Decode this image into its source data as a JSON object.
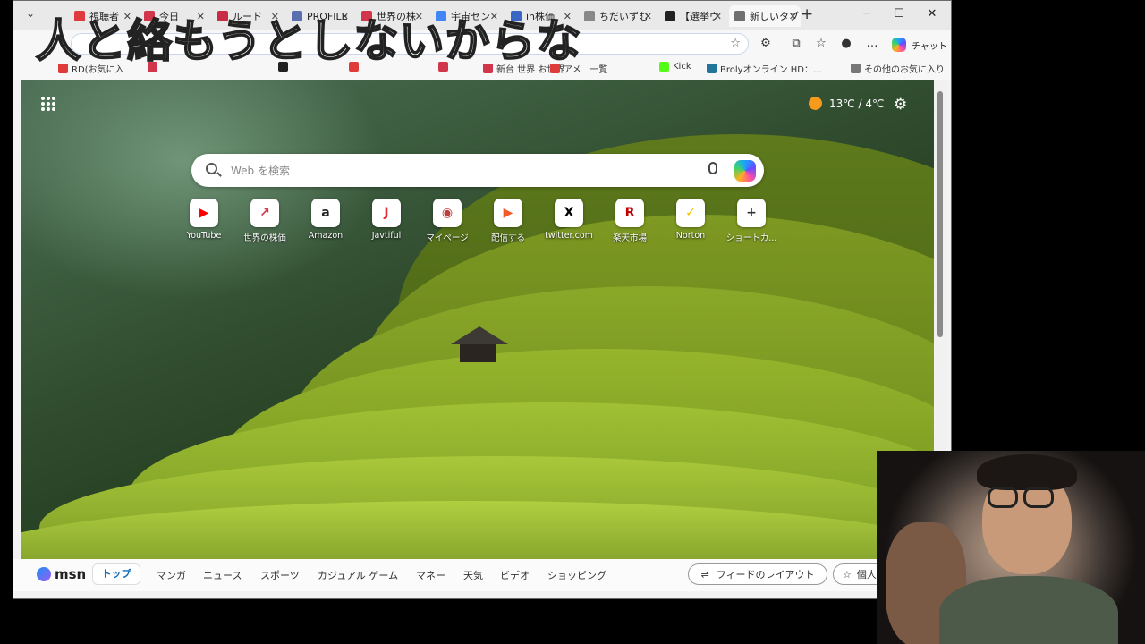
{
  "overlay": {
    "caption": "人と絡もうとしないからな"
  },
  "tabs": [
    {
      "label": "視聴者",
      "color": "#e03b3b",
      "active": false
    },
    {
      "label": "今日",
      "color": "#d1364b",
      "active": false
    },
    {
      "label": "ルード",
      "color": "#c92d45",
      "active": false
    },
    {
      "label": "PROFILE",
      "color": "#5a6fb0",
      "active": false
    },
    {
      "label": "世界の株",
      "color": "#d1364b",
      "active": false
    },
    {
      "label": "宇宙セン",
      "color": "#4285f4",
      "active": false
    },
    {
      "label": "ih株価",
      "color": "#3a66c5",
      "active": false
    },
    {
      "label": "ちだいずむ",
      "color": "#888888",
      "active": false
    },
    {
      "label": "【選挙ウ",
      "color": "#222222",
      "active": false
    },
    {
      "label": "新しいタブ",
      "color": "#6f6f6f",
      "active": true
    }
  ],
  "window_controls": {
    "minimize": "─",
    "maximize": "☐",
    "close": "✕",
    "new_tab": "+",
    "tab_list": "⌄"
  },
  "toolbar": {
    "chat_label": "チャット",
    "more": "…"
  },
  "bookmarks": [
    {
      "label": "RD(お気に入",
      "color": "#e03b3b"
    },
    {
      "label": "",
      "color": "#d1364b"
    },
    {
      "label": "",
      "color": "#222222"
    },
    {
      "label": "",
      "color": "#e03b3b"
    },
    {
      "label": "",
      "color": "#d1364b"
    },
    {
      "label": "新台 世界 お世界",
      "color": "#d1364b"
    },
    {
      "label": "アメ　一覧",
      "color": "#e03b3b"
    },
    {
      "label": "Kick",
      "color": "#53fc18"
    },
    {
      "label": "Brolyオンライン HD：...",
      "color": "#21759b"
    },
    {
      "label": "その他のお気に入り",
      "color": "#777777"
    }
  ],
  "ntp": {
    "weather": "13℃ / 4℃",
    "search_placeholder": "Web を検索",
    "shortcuts": [
      {
        "label": "YouTube",
        "glyph": "▶",
        "color": "#ff0000"
      },
      {
        "label": "世界の株価",
        "glyph": "↗",
        "color": "#d1364b"
      },
      {
        "label": "Amazon",
        "glyph": "a",
        "color": "#222222"
      },
      {
        "label": "Javtiful",
        "glyph": "J",
        "color": "#e0303c"
      },
      {
        "label": "マイページ",
        "glyph": "◉",
        "color": "#c23b3b"
      },
      {
        "label": "配信する",
        "glyph": "▶",
        "color": "#f05a28"
      },
      {
        "label": "twitter.com",
        "glyph": "X",
        "color": "#000000"
      },
      {
        "label": "楽天市場",
        "glyph": "R",
        "color": "#bf0000"
      },
      {
        "label": "Norton",
        "glyph": "✓",
        "color": "#f5c400"
      },
      {
        "label": "ショートカ...",
        "glyph": "+",
        "color": "#333333"
      }
    ]
  },
  "msn": {
    "logo": "msn",
    "nav": [
      "トップ",
      "マンガ",
      "ニュース",
      "スポーツ",
      "カジュアル ゲーム",
      "マネー",
      "天気",
      "ビデオ",
      "ショッピング"
    ],
    "feed_layout": "フィードのレイアウト",
    "personal": "個人"
  }
}
